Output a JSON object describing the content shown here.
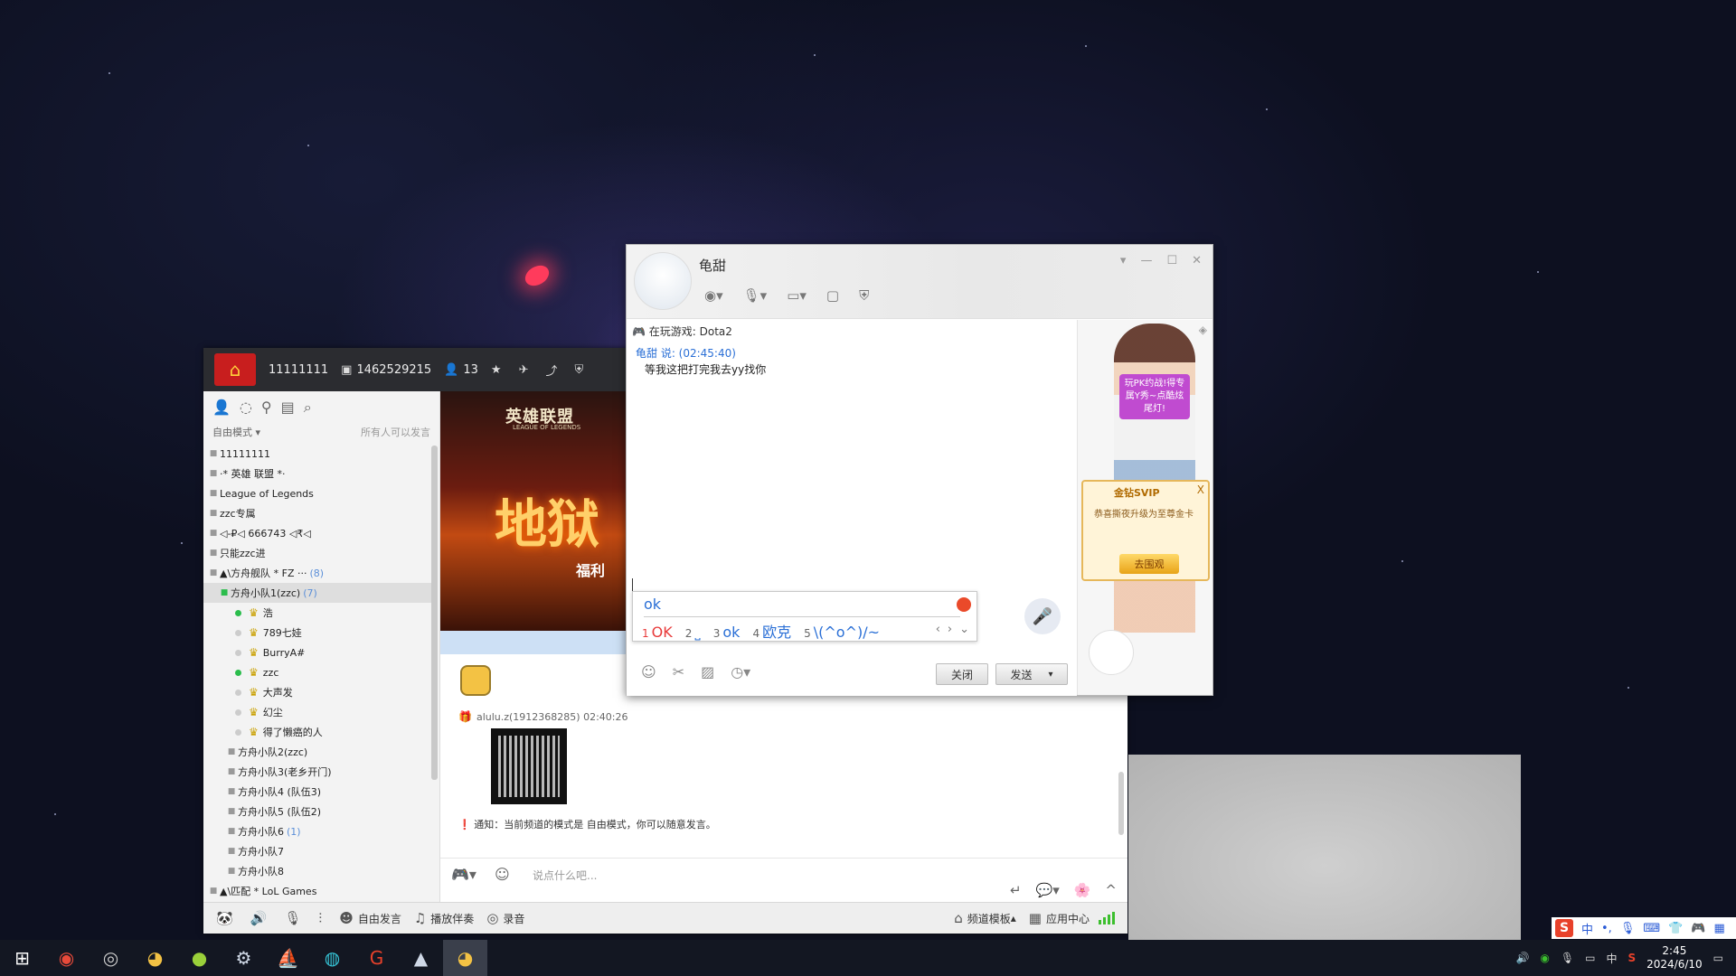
{
  "channel_header": {
    "title": "11111111",
    "channel_id": "1462529215",
    "online": "13"
  },
  "left_panel": {
    "mode": "自由模式",
    "mode_right": "所有人可以发言"
  },
  "channels": [
    {
      "name": "11111111",
      "type": "root"
    },
    {
      "name": "·*    英雄 联盟    *·",
      "type": "lock"
    },
    {
      "name": "League of Legends",
      "type": "lock"
    },
    {
      "name": "zzc专属",
      "type": "lock"
    },
    {
      "name": "◁-₽◁   666743   ◁₹◁",
      "type": "lock"
    },
    {
      "name": "只能zzc进",
      "type": "lock"
    },
    {
      "name": "▲\\方舟舰队         * FZ ···",
      "count": "(8)",
      "type": "lock"
    },
    {
      "name": "方舟小队1(zzc)",
      "count": "(7)",
      "type": "selected"
    },
    {
      "name": "浩",
      "type": "user",
      "online": true
    },
    {
      "name": "789七娃",
      "type": "user",
      "online": false
    },
    {
      "name": "BurryA#",
      "type": "user",
      "online": false
    },
    {
      "name": "zzc",
      "type": "user",
      "online": true
    },
    {
      "name": "大声发",
      "type": "user",
      "online": false
    },
    {
      "name": "幻尘",
      "type": "user",
      "online": false
    },
    {
      "name": "得了懒癌的人",
      "type": "user",
      "online": false
    },
    {
      "name": "方舟小队2(zzc)",
      "type": "sub"
    },
    {
      "name": "方舟小队3(老乡开门)",
      "type": "sub"
    },
    {
      "name": "方舟小队4 (队伍3)",
      "type": "sub"
    },
    {
      "name": "方舟小队5 (队伍2)",
      "type": "sub"
    },
    {
      "name": "方舟小队6",
      "count": "(1)",
      "type": "sub"
    },
    {
      "name": "方舟小队7",
      "type": "sub"
    },
    {
      "name": "方舟小队8",
      "type": "sub"
    },
    {
      "name": "▲\\匹配            * LoL Games",
      "type": "lock"
    }
  ],
  "banner": {
    "title": "英雄联盟",
    "subtitle": "LEAGUE OF LEGENDS",
    "big": "地狱",
    "tag": "福利"
  },
  "chat": {
    "msg_user": "alulu.z(1912368285)",
    "msg_time": "02:40:26",
    "notice": "通知：当前频道的模式是 自由模式，你可以随意发言。",
    "input_placeholder": "说点什么吧..."
  },
  "bottom_bar": {
    "free_speak": "自由发言",
    "play_music": "播放伴奏",
    "record": "录音",
    "template": "频道模板",
    "app_center": "应用中心"
  },
  "popup": {
    "name": "龟甜",
    "playing": "在玩游戏: Dota2",
    "said": "龟甜 说: (02:45:40)",
    "message": "等我这把打完我去yy找你",
    "ime_input": "ok",
    "ime_candidates": [
      {
        "n": "1",
        "t": "OK"
      },
      {
        "n": "2",
        "t": "˽"
      },
      {
        "n": "3",
        "t": "ok"
      },
      {
        "n": "4",
        "t": "欧克"
      },
      {
        "n": "5",
        "t": "\\(^o^)/~"
      }
    ],
    "close_btn": "关闭",
    "send_btn": "发送",
    "ad_text": "玩PK约战!得专属Y秀~点酷炫尾灯!",
    "svip_title": "金钻SVIP",
    "svip_desc": "恭喜撕夜升级为至尊金卡",
    "svip_btn": "去围观"
  },
  "ime_bar": {
    "lang": "中"
  },
  "taskbar": {
    "lang": "中",
    "time": "2:45",
    "date": "2024/6/10"
  }
}
